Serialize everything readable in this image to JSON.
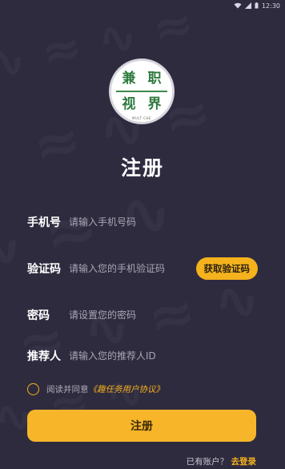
{
  "status_bar": {
    "time": "12:30",
    "icons": [
      "wifi-icon",
      "signal-icon",
      "battery-icon"
    ]
  },
  "logo": {
    "chars": [
      "兼",
      "职",
      "视",
      "界"
    ],
    "subtext": "MULT·CHE"
  },
  "title": "注册",
  "form": {
    "phone": {
      "label": "手机号",
      "placeholder": "请输入手机号码"
    },
    "code": {
      "label": "验证码",
      "placeholder": "请输入您的手机验证码",
      "button": "获取验证码"
    },
    "password": {
      "label": "密码",
      "placeholder": "请设置您的密码"
    },
    "referrer": {
      "label": "推荐人",
      "placeholder": "请输入您的推荐人ID"
    }
  },
  "agreement": {
    "prefix": "阅读并同意",
    "link": "《趣任务用户协议》"
  },
  "register_button": "注册",
  "login": {
    "prefix": "已有账户？",
    "link": "去登录"
  },
  "colors": {
    "background": "#2f2b3f",
    "accent": "#f5b21d",
    "text": "#ffffff",
    "placeholder": "#a8a6b4"
  }
}
